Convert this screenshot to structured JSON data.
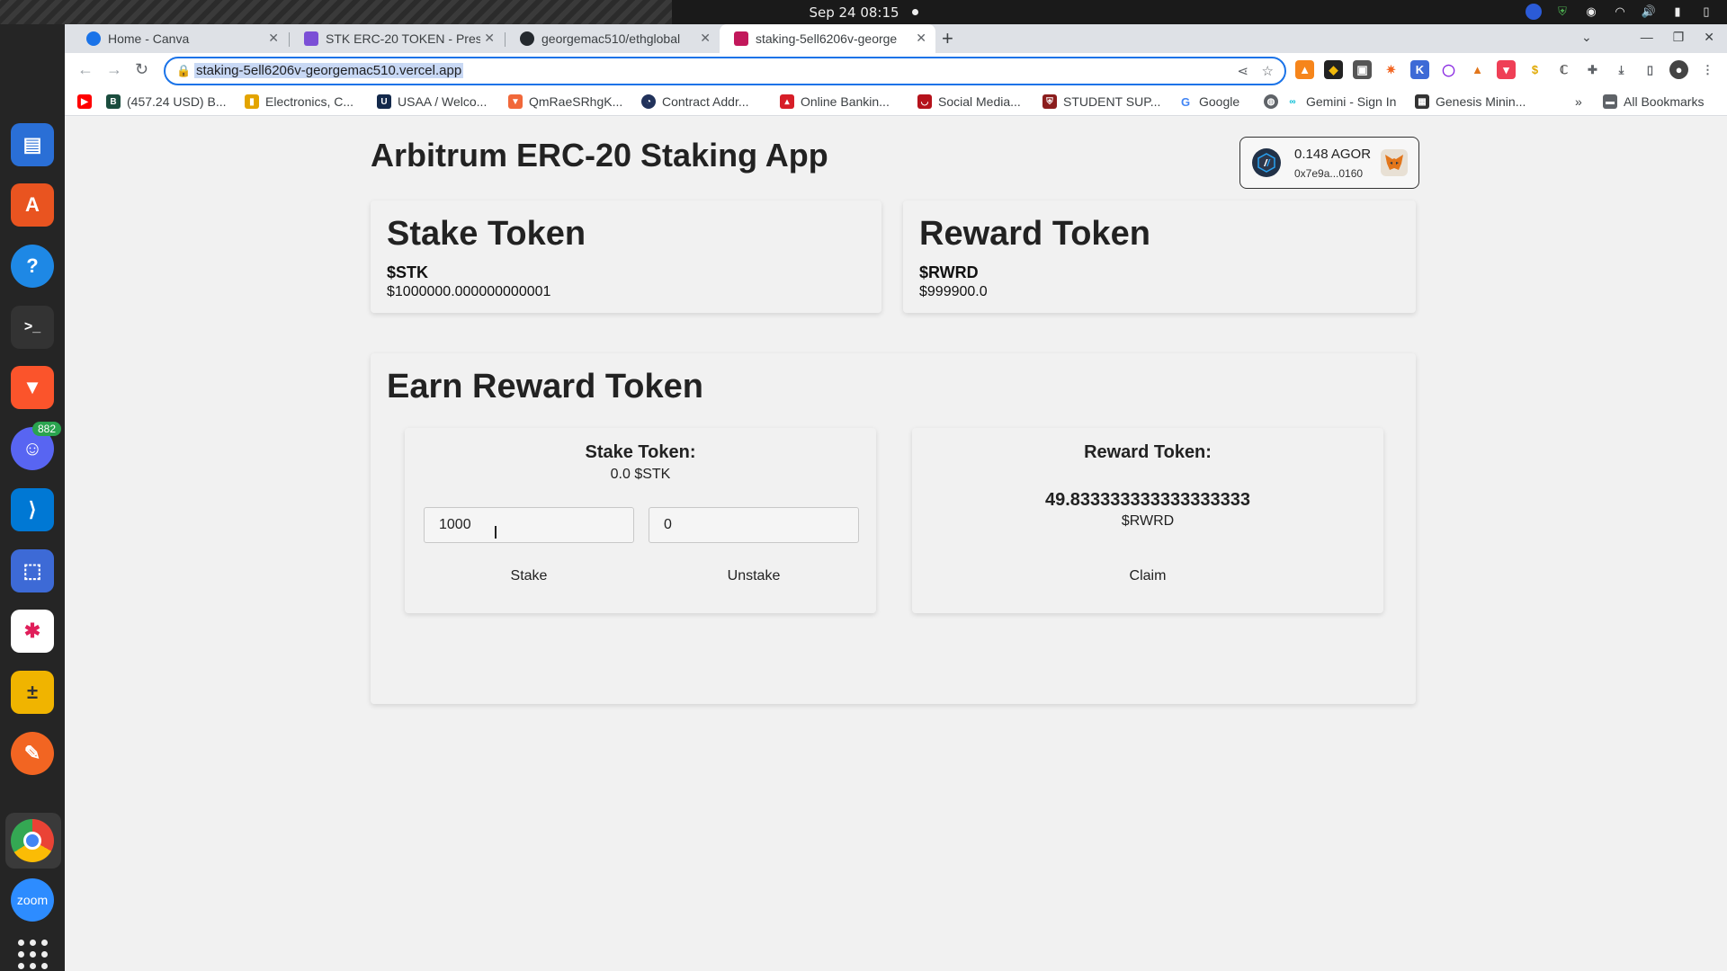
{
  "system": {
    "clock": "Sep 24  08:15",
    "dock": {
      "discord_badge": "882",
      "zoom_label": "zoom"
    }
  },
  "browser": {
    "tabs": [
      {
        "title": "Home - Canva",
        "icon": "canva-icon",
        "color": "#1a73e8"
      },
      {
        "title": "STK ERC-20 TOKEN - Prese",
        "icon": "slides-icon",
        "color": "#7b4fd6"
      },
      {
        "title": "georgemac510/ethglobal",
        "icon": "github-icon",
        "color": "#24292e"
      },
      {
        "title": "staking-5ell6206v-george",
        "icon": "vercel-icon",
        "color": "#c2185b"
      }
    ],
    "url": "staking-5ell6206v-georgemac510.vercel.app",
    "bookmarks": [
      {
        "label": "",
        "icon": "youtube-icon",
        "color": "#ff0000"
      },
      {
        "label": "(457.24 USD) B...",
        "icon": "b-icon",
        "color": "#1b4d3e"
      },
      {
        "label": "Electronics, C...",
        "icon": "shopping-bag-icon",
        "color": "#e3a400"
      },
      {
        "label": "USAA / Welco...",
        "icon": "usaa-icon",
        "color": "#13294b"
      },
      {
        "label": "QmRaeSRhgK...",
        "icon": "brave-icon",
        "color": "#f1683a"
      },
      {
        "label": "Contract Addr...",
        "icon": "etherscan-icon",
        "color": "#21325b"
      },
      {
        "label": "Online Bankin...",
        "icon": "bank-icon",
        "color": "#d71e28"
      },
      {
        "label": "Social Media...",
        "icon": "social-icon",
        "color": "#b5121b"
      },
      {
        "label": "STUDENT SUP...",
        "icon": "shield-icon",
        "color": "#8b1d1d"
      },
      {
        "label": "Google",
        "icon": "google-icon",
        "color": "#4285f4"
      },
      {
        "label": "",
        "icon": "globe-icon",
        "color": "#5f6368"
      },
      {
        "label": "Gemini - Sign In",
        "icon": "gemini-icon",
        "color": "#00dcfa"
      },
      {
        "label": "Genesis Minin...",
        "icon": "grid-icon",
        "color": "#333333"
      }
    ],
    "all_bookmarks": "All Bookmarks"
  },
  "app": {
    "title": "Arbitrum ERC-20 Staking App",
    "wallet": {
      "balance": "0.148 AGOR",
      "address": "0x7e9a...0160"
    },
    "stake_token": {
      "heading": "Stake Token",
      "symbol": "$STK",
      "amount": "$1000000.000000000001"
    },
    "reward_token": {
      "heading": "Reward Token",
      "symbol": "$RWRD",
      "amount": "$999900.0"
    },
    "earn": {
      "heading": "Earn Reward Token",
      "stake_panel": {
        "label": "Stake Token:",
        "staked": "0.0 $STK",
        "stake_input": "1000",
        "unstake_input": "0",
        "stake_button": "Stake",
        "unstake_button": "Unstake"
      },
      "reward_panel": {
        "label": "Reward Token:",
        "earned": "49.833333333333333333",
        "unit": "$RWRD",
        "claim_button": "Claim"
      }
    }
  }
}
